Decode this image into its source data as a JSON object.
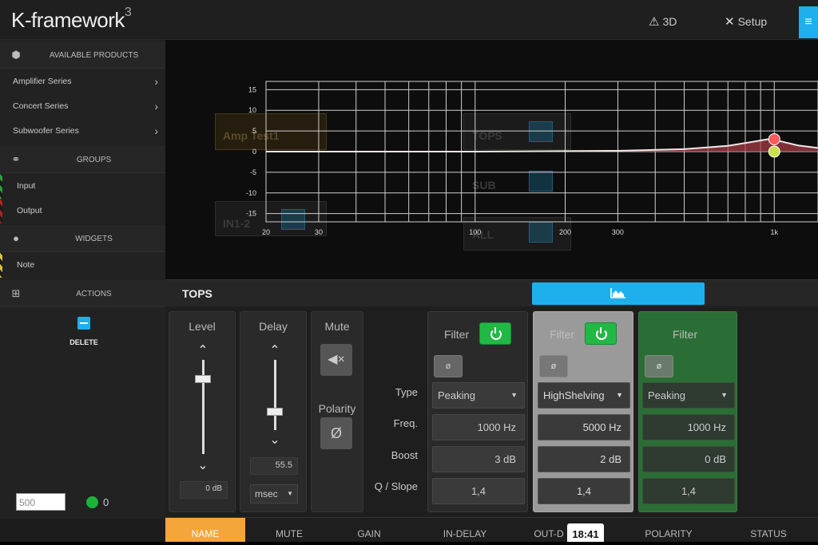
{
  "app": {
    "logo": "K-framework",
    "logo_sup": "3",
    "nav": [
      {
        "label": "3D",
        "icon": "3d-cube-icon"
      },
      {
        "label": "Setup",
        "icon": "wrench-icon"
      }
    ],
    "menu_icon": "hamburger-menu-icon",
    "accent": "#1eb0ec"
  },
  "sidebar": {
    "available_products": {
      "heading": "AVAILABLE PRODUCTS",
      "items": [
        "Amplifier Series",
        "Concert Series",
        "Subwoofer Series"
      ]
    },
    "groups": {
      "heading": "GROUPS",
      "items": [
        "Input",
        "Output"
      ]
    },
    "widgets": {
      "heading": "WIDGETS",
      "items": [
        "Note"
      ]
    },
    "actions": {
      "heading": "ACTIONS",
      "delete_label": "DELETE"
    },
    "value_input": "500",
    "status_count": "0"
  },
  "graph": {
    "ghost_labels": [
      "Amp Test1",
      "TOPS",
      "SUB",
      "ALL",
      "IN1-2"
    ],
    "y_ticks": [
      "15",
      "10",
      "5",
      "0",
      "-5",
      "-10",
      "-15"
    ],
    "x_ticks": [
      "20",
      "30",
      "100",
      "200",
      "300",
      "1k"
    ]
  },
  "chart_data": {
    "type": "line",
    "title": "",
    "xlabel": "",
    "ylabel": "",
    "x_scale": "log",
    "xlim": [
      20,
      1400
    ],
    "ylim": [
      -17,
      17
    ],
    "y_tick_values": [
      15,
      10,
      5,
      0,
      -5,
      -10,
      -15
    ],
    "x_tick_values": [
      20,
      30,
      100,
      200,
      300,
      1000
    ],
    "series": [
      {
        "color": "#b0404a",
        "x": [
          20,
          100,
          300,
          500,
          700,
          850,
          950,
          1050,
          1200,
          1400
        ],
        "y": [
          0,
          0,
          0.2,
          0.6,
          1.4,
          2.4,
          3.0,
          2.5,
          1.5,
          0.9
        ]
      }
    ],
    "markers": [
      {
        "x": 1000,
        "y": 3,
        "color": "#ff5a5a"
      },
      {
        "x": 1000,
        "y": 0,
        "color": "#c8e04a"
      }
    ],
    "grid": true
  },
  "panel": {
    "title": "TOPS",
    "graph_toggle_icon": "area-chart-icon",
    "level": {
      "title": "Level",
      "value": "0 dB",
      "level_fraction": 0.8
    },
    "delay": {
      "title": "Delay",
      "value": "55.5",
      "unit": "msec"
    },
    "mute": {
      "title": "Mute",
      "icon": "speaker-muted-icon"
    },
    "polarity": {
      "title": "Polarity",
      "symbol": "Ø"
    },
    "row_labels": [
      "Type",
      "Freq.",
      "Boost",
      "Q / Slope"
    ],
    "filters": [
      {
        "title": "Filter",
        "phase": "ø",
        "type": "Peaking",
        "freq": "1000 Hz",
        "boost": "3 dB",
        "q": "1,4",
        "enabled": true
      },
      {
        "title": "Filter",
        "phase": "ø",
        "type": "HighShelving",
        "freq": "5000 Hz",
        "boost": "2 dB",
        "q": "1,4",
        "enabled": true
      },
      {
        "title": "Filter",
        "phase": "ø",
        "type": "Peaking",
        "freq": "1000 Hz",
        "boost": "0 dB",
        "q": "1,4",
        "enabled": false
      }
    ]
  },
  "tabs": [
    "NAME",
    "MUTE",
    "GAIN",
    "IN-DELAY",
    "OUT-D",
    "POLARITY",
    "STATUS"
  ],
  "active_tab": "NAME",
  "time_badge": "18:41"
}
